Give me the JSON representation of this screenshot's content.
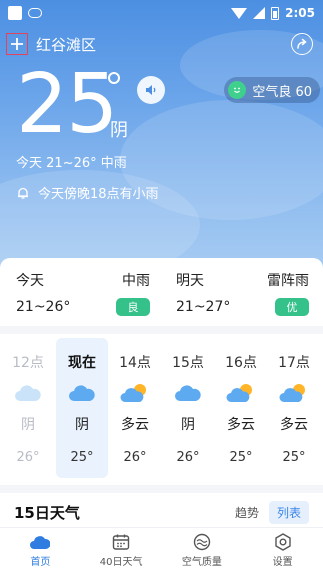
{
  "status_bar": {
    "time": "2:05"
  },
  "header": {
    "city": "红谷滩区"
  },
  "current": {
    "temperature": "25",
    "condition": "阴",
    "today_summary": "今天 21~26° 中雨",
    "alert": "今天傍晚18点有小雨",
    "air_quality": "空气良 60"
  },
  "two_day": [
    {
      "day": "今天",
      "weather": "中雨",
      "temps": "21~26°",
      "aq": "良",
      "aq_color": "#34c18a"
    },
    {
      "day": "明天",
      "weather": "雷阵雨",
      "temps": "21~27°",
      "aq": "优",
      "aq_color": "#34c18a"
    }
  ],
  "hourly": [
    {
      "time": "12点",
      "icon": "cloud-icon",
      "desc": "阴",
      "temp": "26°"
    },
    {
      "time": "现在",
      "icon": "cloud-icon",
      "desc": "阴",
      "temp": "25°"
    },
    {
      "time": "14点",
      "icon": "partly-cloudy-icon",
      "desc": "多云",
      "temp": "26°"
    },
    {
      "time": "15点",
      "icon": "cloud-icon",
      "desc": "阴",
      "temp": "26°"
    },
    {
      "time": "16点",
      "icon": "partly-cloudy-icon",
      "desc": "多云",
      "temp": "25°"
    },
    {
      "time": "17点",
      "icon": "partly-cloudy-icon",
      "desc": "多云",
      "temp": "25°"
    }
  ],
  "fifteen_day": {
    "title": "15日天气",
    "tab_trend": "趋势",
    "tab_list": "列表"
  },
  "bottom_nav": [
    {
      "label": "首页",
      "icon": "home-icon",
      "active": true
    },
    {
      "label": "40日天气",
      "icon": "calendar-icon",
      "active": false
    },
    {
      "label": "空气质量",
      "icon": "air-quality-icon",
      "active": false
    },
    {
      "label": "设置",
      "icon": "settings-icon",
      "active": false
    }
  ],
  "colors": {
    "accent": "#2f7de1",
    "aq_good": "#34c18a",
    "sky_top": "#4c8fe2",
    "sky_bottom": "#a9cdf3"
  }
}
